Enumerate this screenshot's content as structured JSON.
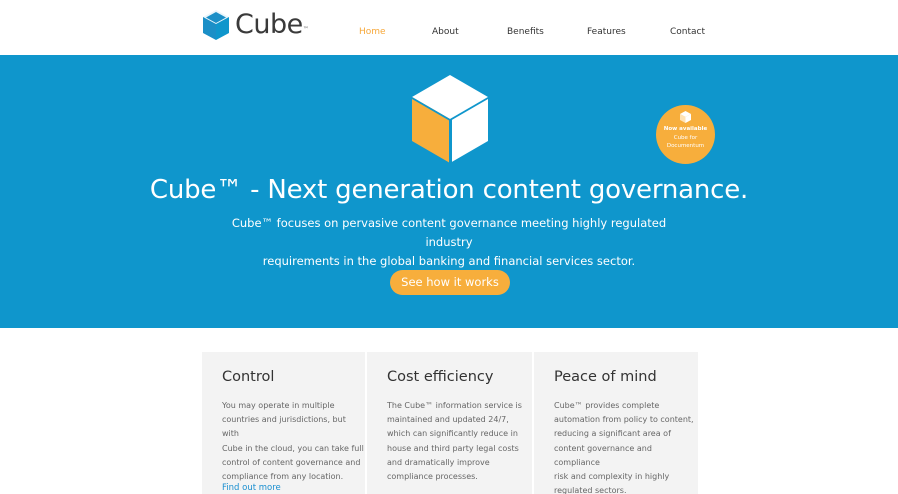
{
  "header": {
    "logo_text": "Cube",
    "logo_tm": "™",
    "nav": [
      {
        "label": "Home",
        "active": true
      },
      {
        "label": "About",
        "active": false
      },
      {
        "label": "Benefits",
        "active": false
      },
      {
        "label": "Features",
        "active": false
      },
      {
        "label": "Contact",
        "active": false
      }
    ]
  },
  "hero": {
    "title": "Cube™ - Next generation content governance.",
    "subtitle_line1": "Cube™ focuses on pervasive content governance meeting highly regulated industry",
    "subtitle_line2": "requirements in the global banking and financial services sector.",
    "button_label": "See how it works",
    "badge": {
      "line1": "Now available",
      "line2": "Cube for",
      "line3": "Documentum"
    }
  },
  "features": [
    {
      "title": "Control",
      "text": [
        "You may operate in multiple",
        "countries and jurisdictions, but with",
        "Cube in the cloud, you can take full",
        "control of content governance and",
        "compliance from any location."
      ],
      "link": "Find out more"
    },
    {
      "title": "Cost efficiency",
      "text": [
        "The Cube™ information service is",
        "maintained and updated 24/7,",
        "which can significantly reduce in",
        "house and third party legal costs",
        "and dramatically improve",
        "compliance processes."
      ]
    },
    {
      "title": "Peace of mind",
      "text": [
        "Cube™ provides complete",
        "automation from policy to content,",
        "reducing a significant area of",
        "content governance and compliance",
        "risk and complexity in highly",
        "regulated sectors."
      ]
    }
  ],
  "colors": {
    "accent_blue": "#0f96cc",
    "accent_orange": "#f7ae3c",
    "card_bg": "#f3f3f3",
    "link_blue": "#1a8fd0"
  },
  "icons": {
    "logo": "cube-icon",
    "hero": "cube-icon",
    "badge": "cube-icon"
  }
}
